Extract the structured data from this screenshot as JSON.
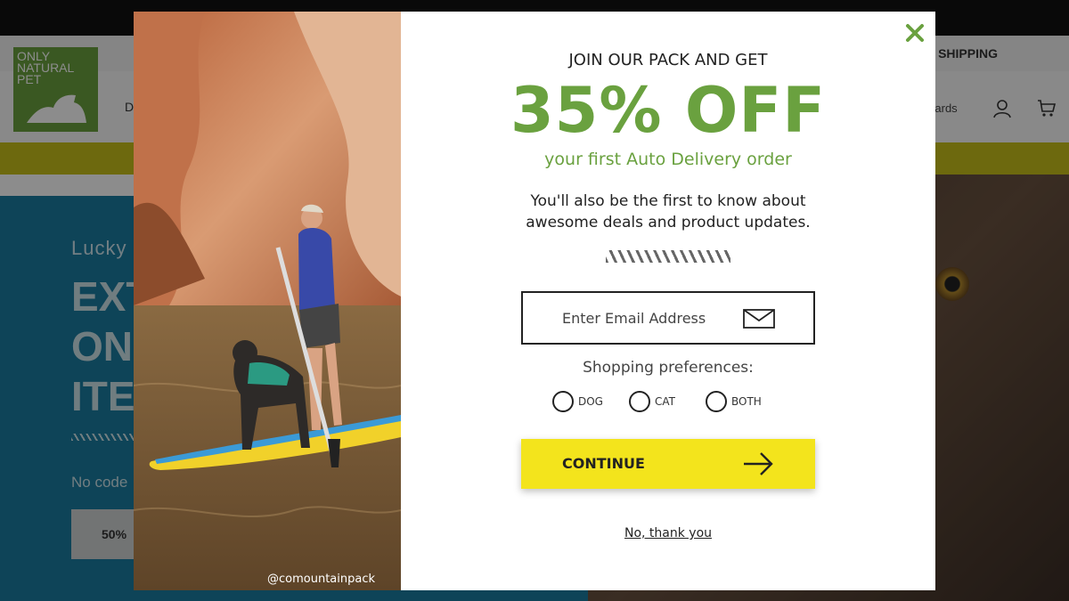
{
  "background_page": {
    "promo_text": "SHIPPING",
    "logo_text": "ONLY NATURAL PET",
    "nav_fragment": "D",
    "rewards_fragment": "wards",
    "hero": {
      "small_text": "Lucky",
      "big_text": "EXT\nON\nITE",
      "no_code_text": "No code",
      "button_text": "50%"
    }
  },
  "modal": {
    "join_text": "JOIN OUR PACK AND GET",
    "offer": "35% OFF",
    "offer_sub": "your first Auto Delivery order",
    "description": "You'll also be the first to know about awesome deals and product updates.",
    "email": {
      "placeholder": "Enter Email Address",
      "value": ""
    },
    "prefs_label": "Shopping preferences:",
    "pref_options": [
      "DOG",
      "CAT",
      "BOTH"
    ],
    "continue_label": "CONTINUE",
    "decline_label": "No, thank you",
    "photo_credit": "@comountainpack",
    "icons": {
      "close": "close-icon",
      "mail": "mail-icon",
      "arrow": "arrow-right-icon"
    }
  },
  "colors": {
    "brand_green": "#6aa13f",
    "continue_yellow": "#f3e41c",
    "hero_blue": "#1a7ca0"
  }
}
